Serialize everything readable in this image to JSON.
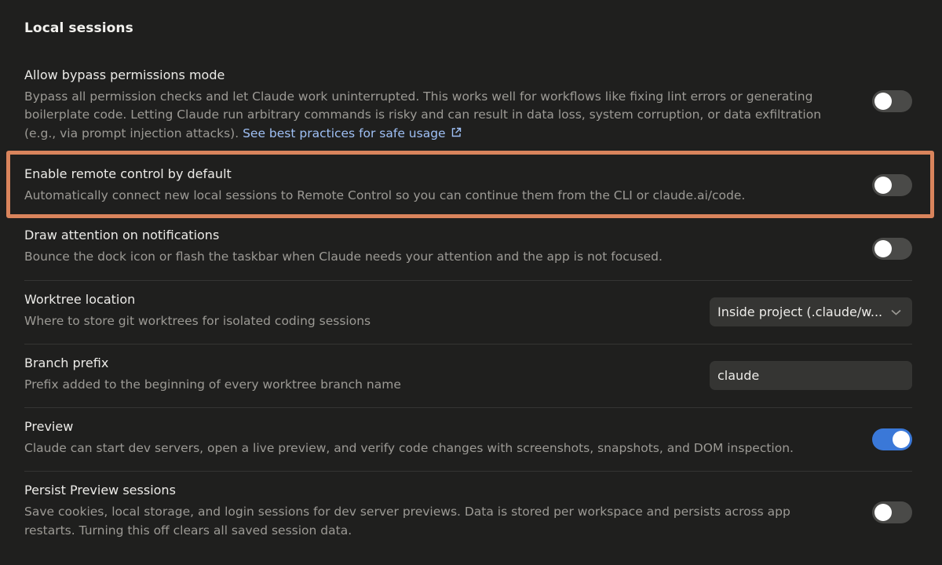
{
  "section": {
    "title": "Local sessions"
  },
  "settings": {
    "bypass": {
      "title": "Allow bypass permissions mode",
      "desc": "Bypass all permission checks and let Claude work uninterrupted. This works well for workflows like fixing lint errors or generating boilerplate code. Letting Claude run arbitrary commands is risky and can result in data loss, system corruption, or data exfiltration (e.g., via prompt injection attacks).",
      "link": "See best practices for safe usage",
      "enabled": false
    },
    "remote": {
      "title": "Enable remote control by default",
      "desc": "Automatically connect new local sessions to Remote Control so you can continue them from the CLI or claude.ai/code.",
      "enabled": false
    },
    "attention": {
      "title": "Draw attention on notifications",
      "desc": "Bounce the dock icon or flash the taskbar when Claude needs your attention and the app is not focused.",
      "enabled": false
    },
    "worktree": {
      "title": "Worktree location",
      "desc": "Where to store git worktrees for isolated coding sessions",
      "value": "Inside project (.claude/w..."
    },
    "branch": {
      "title": "Branch prefix",
      "desc": "Prefix added to the beginning of every worktree branch name",
      "value": "claude"
    },
    "preview": {
      "title": "Preview",
      "desc": "Claude can start dev servers, open a live preview, and verify code changes with screenshots, snapshots, and DOM inspection.",
      "enabled": true
    },
    "persist": {
      "title": "Persist Preview sessions",
      "desc": "Save cookies, local storage, and login sessions for dev server previews. Data is stored per workspace and persists across app restarts. Turning this off clears all saved session data.",
      "enabled": false
    }
  },
  "colors": {
    "highlight": "#d9845c",
    "toggle_on": "#3a78d8",
    "link": "#9fc0f5"
  }
}
